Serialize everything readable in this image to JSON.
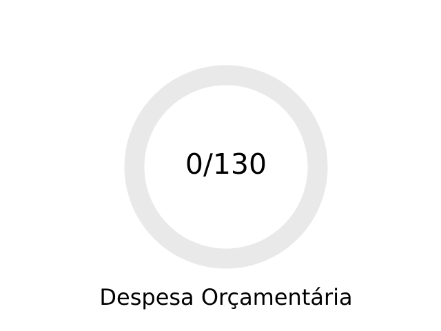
{
  "gauge": {
    "current": 0,
    "total": 130,
    "display_text": "0/130",
    "progress_fraction": 0,
    "track_color": "#e9e9e9",
    "fill_color": "#4a90d9",
    "label": "Despesa Orçamentária"
  }
}
